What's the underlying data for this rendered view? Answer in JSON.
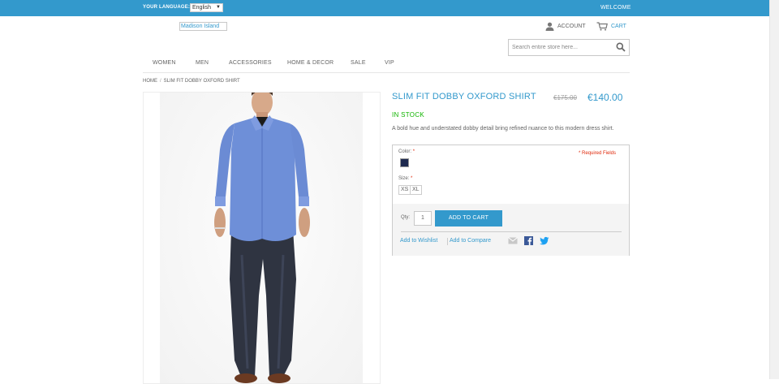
{
  "header": {
    "language_label": "YOUR LANGUAGE:",
    "language_value": "English",
    "welcome": "WELCOME",
    "logo_alt": "Madison Island",
    "account_label": "ACCOUNT",
    "cart_label": "CART",
    "search_placeholder": "Search entire store here..."
  },
  "nav": {
    "items": [
      {
        "label": "WOMEN"
      },
      {
        "label": "MEN"
      },
      {
        "label": "ACCESSORIES"
      },
      {
        "label": "HOME & DECOR"
      },
      {
        "label": "SALE"
      },
      {
        "label": "VIP"
      }
    ]
  },
  "breadcrumb": {
    "home": "HOME",
    "separator": "/",
    "current": "SLIM FIT DOBBY OXFORD SHIRT"
  },
  "product": {
    "name": "SLIM FIT DOBBY OXFORD SHIRT",
    "old_price": "€175.00",
    "price": "€140.00",
    "availability": "IN STOCK",
    "description": "A bold hue and understated dobby detail bring refined nuance to this modern dress shirt.",
    "image_semantic": "man wearing blue dress shirt and dark jeans"
  },
  "options": {
    "color_label": "Color:",
    "color_value": "#1e2a4f",
    "required_note": "* Required Fields",
    "required_marker": "*",
    "size_label": "Size:",
    "sizes": [
      "XS",
      "XL"
    ],
    "qty_label": "Qty:",
    "qty_value": "1",
    "add_to_cart": "ADD TO CART",
    "add_to_wishlist": "Add to Wishlist",
    "add_to_compare": "Add to Compare"
  },
  "colors": {
    "accent": "#3399cc",
    "in_stock": "#11b400",
    "required": "#df280a",
    "facebook": "#3b5998",
    "twitter": "#1da1f2"
  }
}
